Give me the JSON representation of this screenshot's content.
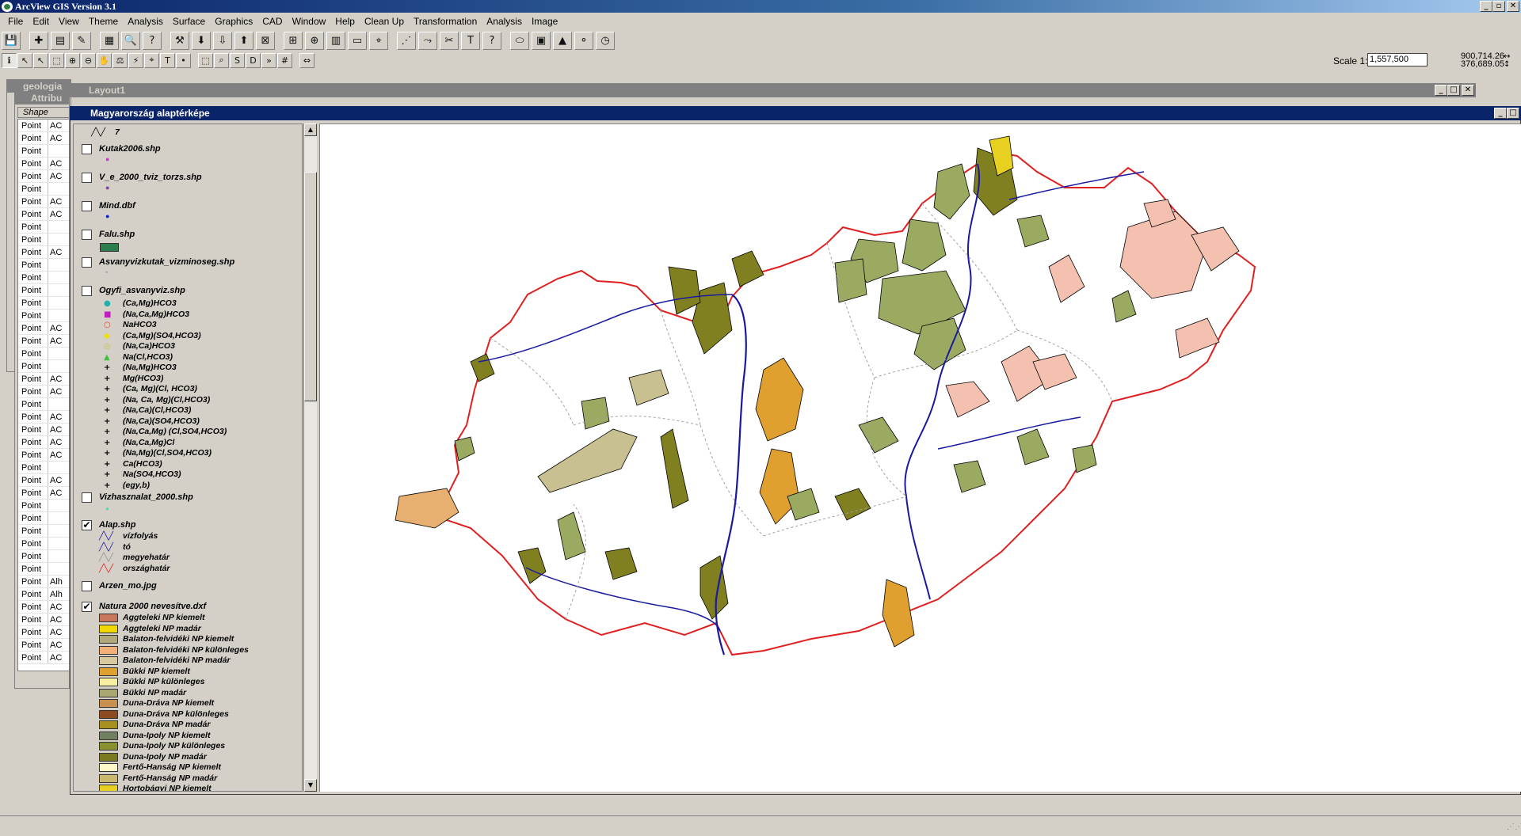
{
  "app": {
    "title": "ArcView GIS Version 3.1"
  },
  "menu": [
    "File",
    "Edit",
    "View",
    "Theme",
    "Analysis",
    "Surface",
    "Graphics",
    "CAD",
    "Window",
    "Help",
    "Clean Up",
    "Transformation",
    "Analysis",
    "Image"
  ],
  "toolbar": {
    "scale_label": "Scale 1:",
    "scale_value": "1,557,500",
    "coord_x": "900,714.26",
    "coord_y": "376,689.05",
    "coord_arrows": "↔\n↕"
  },
  "windows": {
    "geologia_title": "geologia",
    "attrib_title": "Attribu",
    "attrib_header": "Shape",
    "layout_title": "Layout1",
    "view_title": "Magyarország alaptérképe"
  },
  "attrib_rows": [
    [
      "Point",
      "AC"
    ],
    [
      "Point",
      "AC"
    ],
    [
      "Point",
      ""
    ],
    [
      "Point",
      "AC"
    ],
    [
      "Point",
      "AC"
    ],
    [
      "Point",
      ""
    ],
    [
      "Point",
      "AC"
    ],
    [
      "Point",
      "AC"
    ],
    [
      "Point",
      ""
    ],
    [
      "Point",
      ""
    ],
    [
      "Point",
      "AC"
    ],
    [
      "Point",
      ""
    ],
    [
      "Point",
      ""
    ],
    [
      "Point",
      ""
    ],
    [
      "Point",
      ""
    ],
    [
      "Point",
      ""
    ],
    [
      "Point",
      "AC"
    ],
    [
      "Point",
      "AC"
    ],
    [
      "Point",
      ""
    ],
    [
      "Point",
      ""
    ],
    [
      "Point",
      "AC"
    ],
    [
      "Point",
      "AC"
    ],
    [
      "Point",
      ""
    ],
    [
      "Point",
      "AC"
    ],
    [
      "Point",
      "AC"
    ],
    [
      "Point",
      "AC"
    ],
    [
      "Point",
      "AC"
    ],
    [
      "Point",
      ""
    ],
    [
      "Point",
      "AC"
    ],
    [
      "Point",
      "AC"
    ],
    [
      "Point",
      ""
    ],
    [
      "Point",
      ""
    ],
    [
      "Point",
      ""
    ],
    [
      "Point",
      ""
    ],
    [
      "Point",
      ""
    ],
    [
      "Point",
      ""
    ],
    [
      "Point",
      "Alh"
    ],
    [
      "Point",
      "Alh"
    ],
    [
      "Point",
      "AC"
    ],
    [
      "Point",
      "AC"
    ],
    [
      "Point",
      "AC"
    ],
    [
      "Point",
      "AC"
    ],
    [
      "Point",
      "AC"
    ]
  ],
  "toc": {
    "top_label": "7",
    "layers": [
      {
        "name": "Kutak2006.shp",
        "checked": false
      },
      {
        "name": "V_e_2000_tviz_torzs.shp",
        "checked": false
      },
      {
        "name": "Mind.dbf",
        "checked": false
      },
      {
        "name": "Falu.shp",
        "checked": false
      },
      {
        "name": "Asvanyvizkutak_vizminoseg.shp",
        "checked": false
      },
      {
        "name": "Ogyfi_asvanyviz.shp",
        "checked": false
      },
      {
        "name": "Vizhasznalat_2000.shp",
        "checked": false
      },
      {
        "name": "Alap.shp",
        "checked": true
      },
      {
        "name": "Arzen_mo.jpg",
        "checked": false
      },
      {
        "name": "Natura 2000 nevesítve.dxf",
        "checked": true
      }
    ],
    "ogyfi_classes": [
      "(Ca,Mg)HCO3",
      "(Na,Ca,Mg)HCO3",
      "NaHCO3",
      "(Ca,Mg)(SO4,HCO3)",
      "(Na,Ca)HCO3",
      "Na(Cl,HCO3)",
      "(Na,Mg)HCO3",
      "Mg(HCO3)",
      "(Ca, Mg)(Cl, HCO3)",
      "(Na, Ca, Mg)(Cl,HCO3)",
      "(Na,Ca)(Cl,HCO3)",
      "(Na,Ca)(SO4,HCO3)",
      "(Na,Ca,Mg) (Cl,SO4,HCO3)",
      "(Na,Ca,Mg)Cl",
      "(Na,Mg)(Cl,SO4,HCO3)",
      "Ca(HCO3)",
      "Na(SO4,HCO3)",
      "(egy,b)"
    ],
    "alap_classes": [
      "vízfolyás",
      "tó",
      "megyehatár",
      "országhatár"
    ],
    "natura_classes": [
      {
        "label": "Aggteleki NP kiemelt",
        "color": "#c8785a"
      },
      {
        "label": "Aggteleki NP madár",
        "color": "#f0d800"
      },
      {
        "label": "Balaton-felvidéki NP kiemelt",
        "color": "#b0a878"
      },
      {
        "label": "Balaton-felvidéki NP különleges",
        "color": "#f0b078"
      },
      {
        "label": "Balaton-felvidéki NP madár",
        "color": "#d8c8a0"
      },
      {
        "label": "Bükki NP kiemelt",
        "color": "#e0a030"
      },
      {
        "label": "Bükki NP különleges",
        "color": "#f8f0a0"
      },
      {
        "label": "Bükki NP madár",
        "color": "#a8a870"
      },
      {
        "label": "Duna-Dráva NP kiemelt",
        "color": "#c89050"
      },
      {
        "label": "Duna-Dráva NP különleges",
        "color": "#8b4a20"
      },
      {
        "label": "Duna-Dráva NP madár",
        "color": "#a89020"
      },
      {
        "label": "Duna-Ipoly NP kiemelt",
        "color": "#708060"
      },
      {
        "label": "Duna-Ipoly NP különleges",
        "color": "#889030"
      },
      {
        "label": "Duna-Ipoly NP madár",
        "color": "#7a7a20"
      },
      {
        "label": "Fertő-Hanság NP kiemelt",
        "color": "#fff8c8"
      },
      {
        "label": "Fertő-Hanság NP madár",
        "color": "#c8b870"
      },
      {
        "label": "Hortobágyi NP kiemelt",
        "color": "#e8d020"
      }
    ]
  },
  "colors": {
    "border": "#e02020",
    "river": "#1a1aa0",
    "county": "#a0a0a0",
    "selection_title": "#0a246a",
    "patch_green": "#9aaa60",
    "patch_pink": "#f4c0b0",
    "patch_orange": "#e0a030",
    "patch_olive": "#808020",
    "patch_khaki": "#c8c090"
  },
  "icons": {
    "toolbar1": [
      "save-icon",
      "add-theme-icon",
      "theme-properties-icon",
      "edit-legend-icon",
      "open-table-icon",
      "find-icon",
      "query-icon",
      "locate-icon",
      "table-icon",
      "chart-icon",
      "layout-icon",
      "zoom-full-icon",
      "zoom-active-icon",
      "zoom-selected-icon",
      "select-all-icon",
      "clear-selection-icon",
      "help-icon",
      "legend-icon",
      "grid-icon",
      "image-icon",
      "cad-icon",
      "transform-icon",
      "globe-icon",
      "help-arrow-icon",
      "view-icon",
      "table2-icon",
      "script-icon"
    ],
    "toolbar2": [
      "info-icon",
      "pointer-icon",
      "vertex-icon",
      "select-icon",
      "zoom-in-icon",
      "zoom-out-icon",
      "pan-icon",
      "measure-icon",
      "hotlink-icon",
      "label-icon",
      "text-icon",
      "draw-icon",
      "area-icon",
      "find-region-icon",
      "s-icon",
      "d-icon",
      "next-icon",
      "grid-tool-icon",
      "split-icon"
    ]
  }
}
